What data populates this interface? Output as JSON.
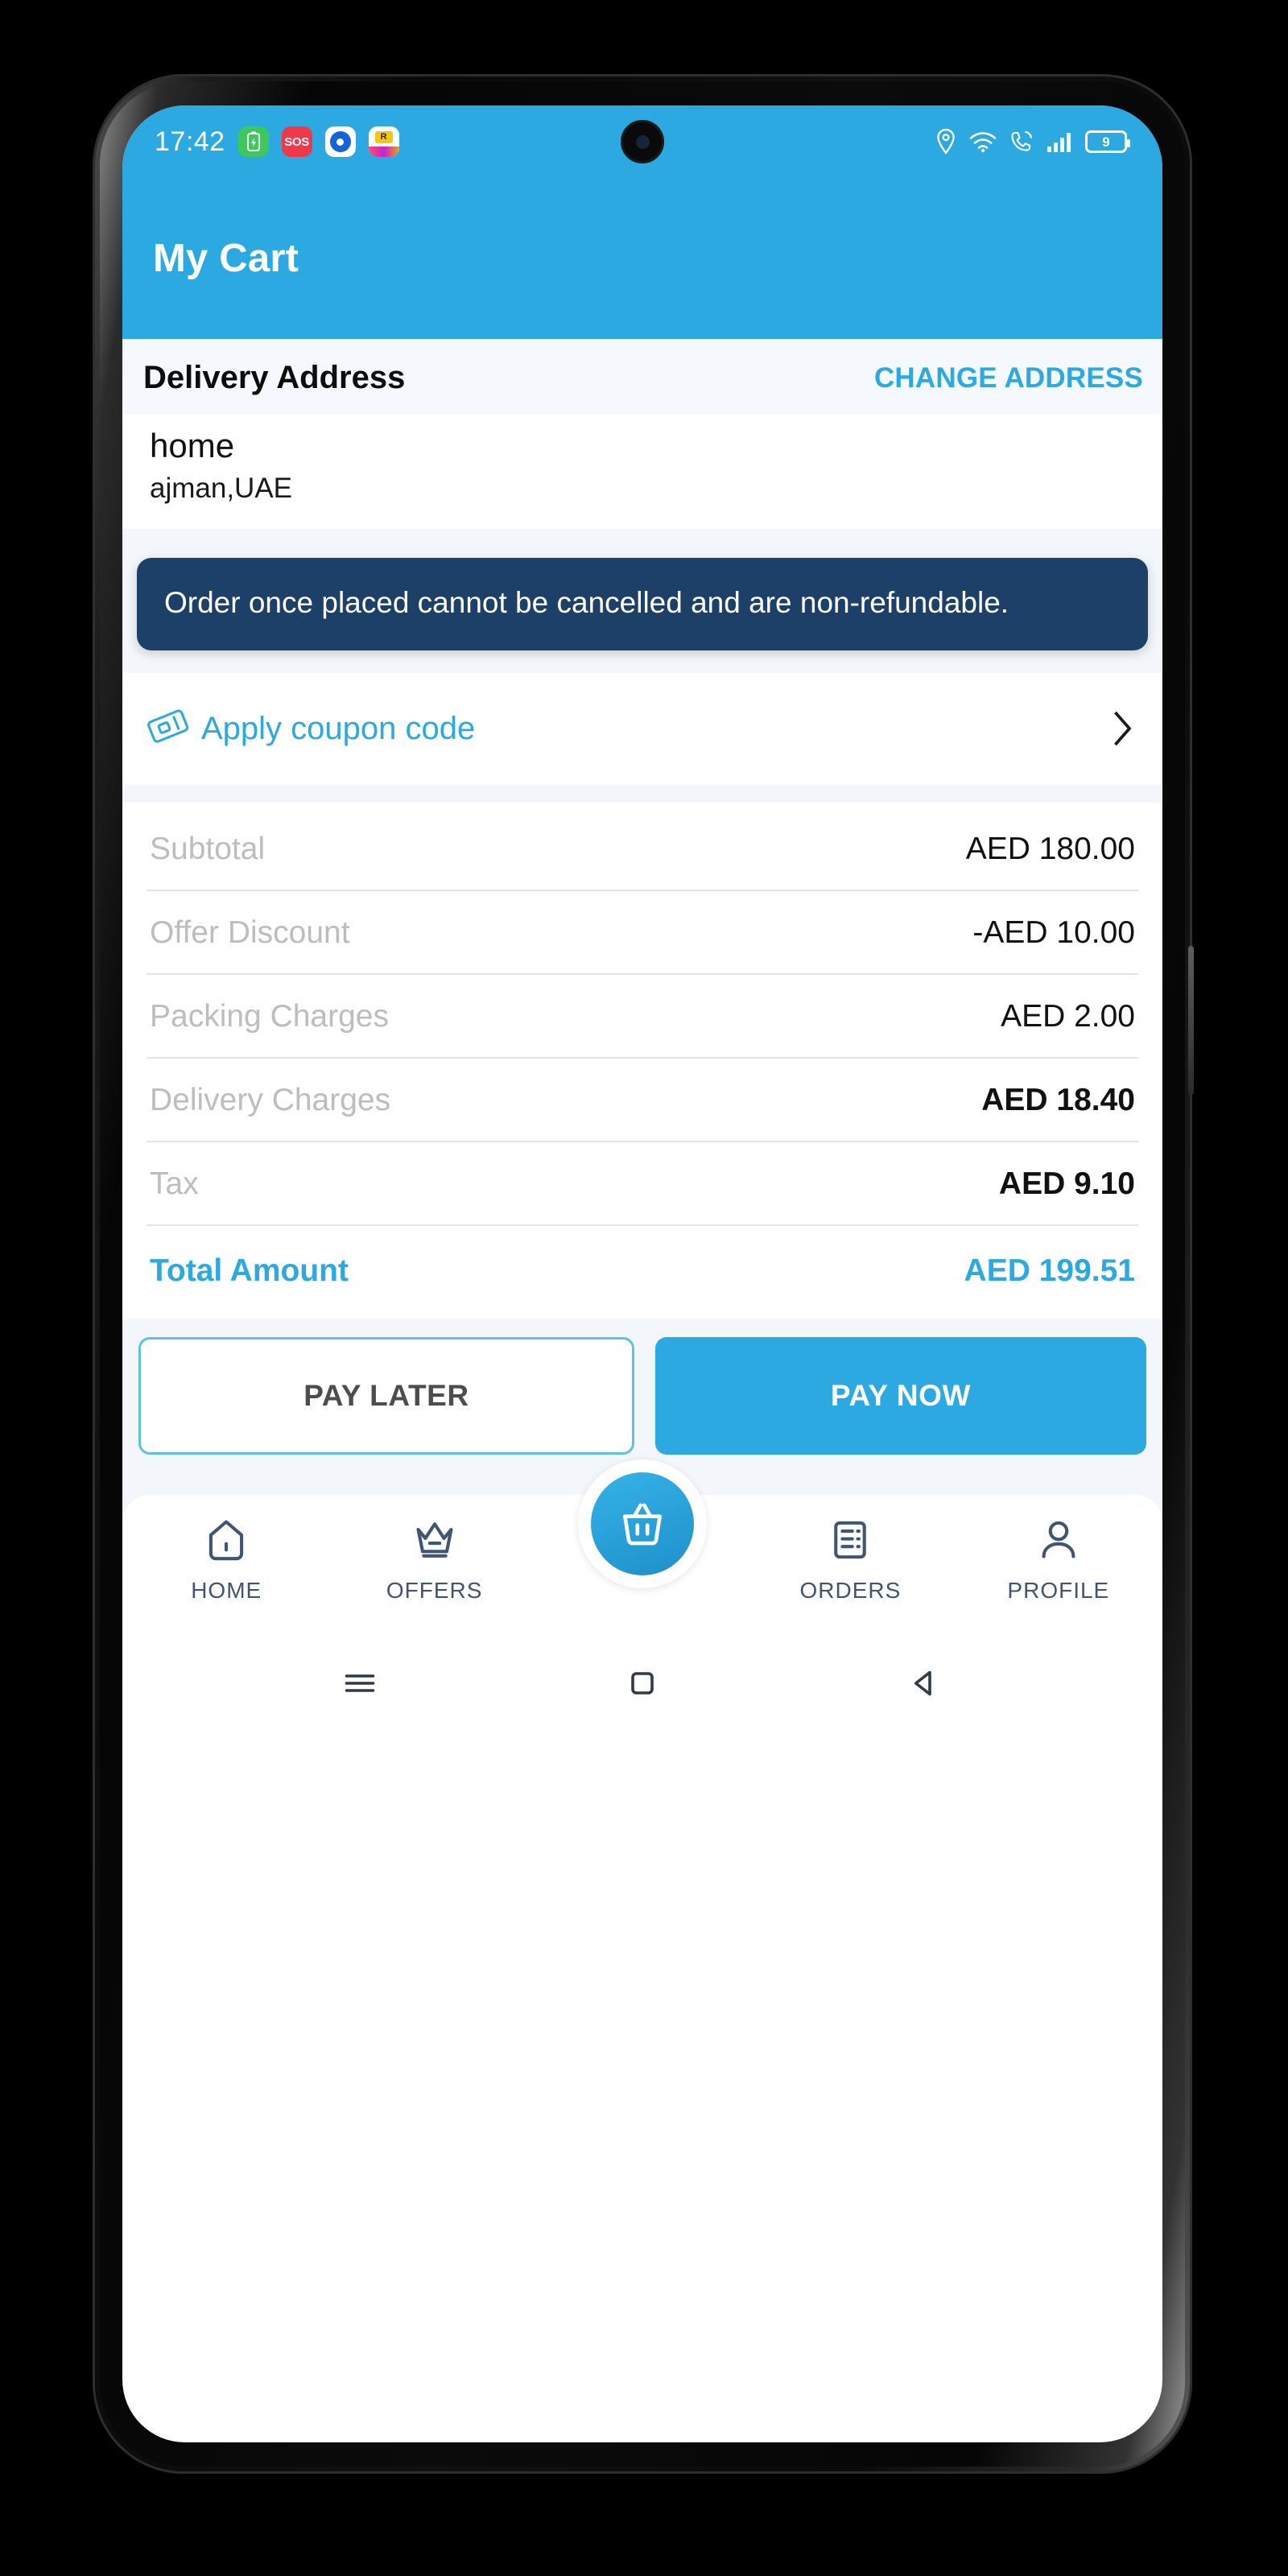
{
  "statusbar": {
    "clock": "17:42",
    "left_icons": [
      {
        "name": "battery-saver-icon",
        "label": ""
      },
      {
        "name": "sos-icon",
        "label": "SOS"
      },
      {
        "name": "media-player-icon",
        "label": ""
      },
      {
        "name": "shopping-app-icon",
        "label": "R"
      }
    ],
    "right_icons": [
      "location-icon",
      "wifi-icon",
      "call-icon",
      "signal-icon"
    ],
    "battery_level": "9"
  },
  "appbar": {
    "title": "My Cart"
  },
  "address": {
    "section_title": "Delivery Address",
    "change_label": "CHANGE ADDRESS",
    "name": "home",
    "line": "ajman,UAE"
  },
  "notice": {
    "text": "Order once placed cannot be cancelled and are non-refundable."
  },
  "coupon": {
    "label": "Apply coupon code",
    "icon": "coupon-ticket-icon",
    "chevron": "chevron-right-icon"
  },
  "summary": {
    "rows": [
      {
        "label": "Subtotal",
        "value": "AED 180.00",
        "bold": false
      },
      {
        "label": "Offer Discount",
        "value": "-AED 10.00",
        "bold": false
      },
      {
        "label": "Packing Charges",
        "value": "AED 2.00",
        "bold": false
      },
      {
        "label": "Delivery Charges",
        "value": "AED 18.40",
        "bold": true
      },
      {
        "label": "Tax",
        "value": "AED 9.10",
        "bold": true
      }
    ],
    "total": {
      "label": "Total Amount",
      "value": "AED 199.51"
    }
  },
  "actions": {
    "pay_later": "PAY LATER",
    "pay_now": "PAY NOW"
  },
  "bottomnav": {
    "items": [
      {
        "label": "HOME",
        "icon": "home-icon"
      },
      {
        "label": "OFFERS",
        "icon": "crown-icon"
      },
      {
        "label": "ORDERS",
        "icon": "receipt-icon"
      },
      {
        "label": "PROFILE",
        "icon": "person-icon"
      }
    ],
    "fab": {
      "icon": "basket-icon"
    }
  },
  "androidnav": {
    "items": [
      "menu-icon",
      "home-square-icon",
      "back-triangle-icon"
    ]
  },
  "colors": {
    "brand_blue": "#2ba9e0",
    "notice_navy": "#1d4068",
    "muted_label": "#bdbdbd",
    "nav_slate": "#3f5573"
  }
}
